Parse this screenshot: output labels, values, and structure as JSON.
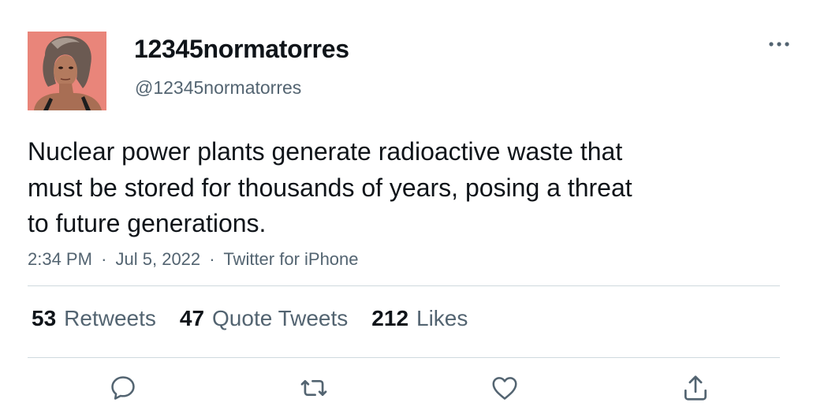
{
  "author": {
    "display_name": "12345normatorres",
    "handle": "@12345normatorres",
    "avatar_icon": "user-avatar"
  },
  "tweet": {
    "text_lines": [
      "Nuclear power plants generate radioactive waste that",
      "must be stored for thousands of years, posing a threat",
      "to future generations."
    ],
    "time": "2:34 PM",
    "separator": "·",
    "date": "Jul 5, 2022",
    "source": "Twitter for iPhone"
  },
  "stats": [
    {
      "count": "53",
      "label": "Retweets"
    },
    {
      "count": "47",
      "label": "Quote Tweets"
    },
    {
      "count": "212",
      "label": "Likes"
    }
  ],
  "actions": [
    "reply-icon",
    "retweet-icon",
    "like-icon",
    "share-icon"
  ],
  "colors": {
    "primary_text": "#0f1419",
    "secondary_text": "#536471",
    "divider": "#cfd9de",
    "avatar_bg": "#e9857a"
  }
}
